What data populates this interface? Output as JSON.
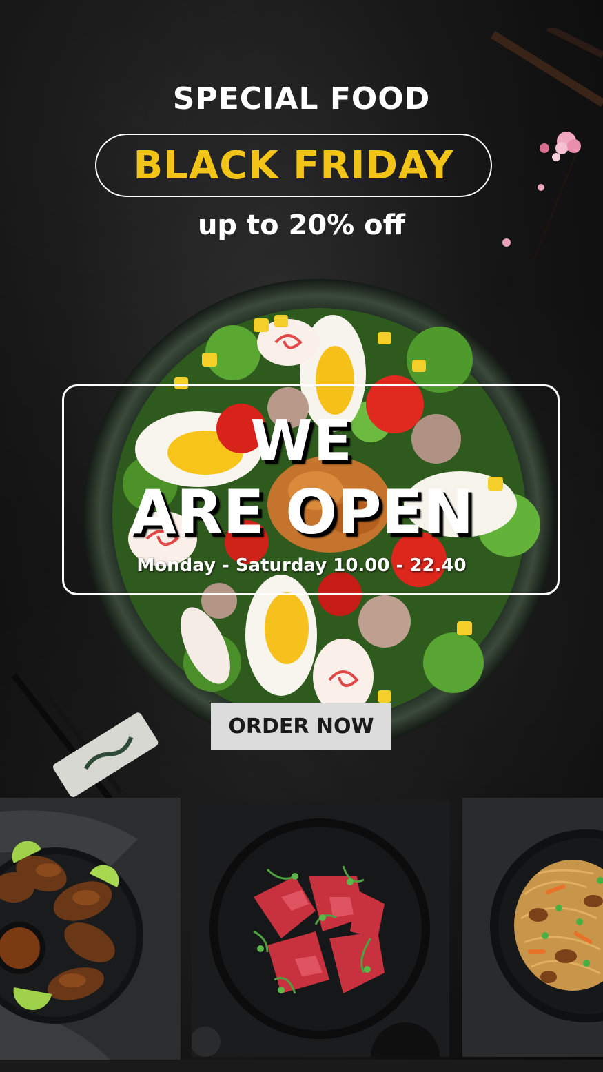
{
  "header": {
    "eyebrow": "SPECIAL FOOD",
    "headline": "BLACK FRIDAY",
    "offer": "up to 20% off"
  },
  "banner": {
    "line1": "WE",
    "line2": "ARE OPEN",
    "hours": "Monday - Saturday 10.00 - 22.40"
  },
  "cta": {
    "label": "ORDER NOW"
  },
  "thumbnails": [
    {
      "icon": "chicken-wings-dish"
    },
    {
      "icon": "beef-carpaccio-dish"
    },
    {
      "icon": "noodles-dish"
    }
  ],
  "colors": {
    "accent": "#f3c418",
    "background": "#111111",
    "text": "#ffffff",
    "button": "#dcdcdc"
  }
}
